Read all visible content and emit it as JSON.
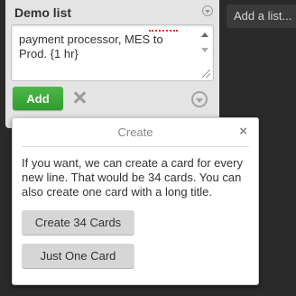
{
  "list": {
    "title": "Demo list",
    "composer_text": "payment processor, MES to Prod. {1 hr}",
    "add_label": "Add"
  },
  "add_list": {
    "label": "Add a list..."
  },
  "popover": {
    "title": "Create",
    "close_label": "×",
    "message": "If you want, we can create a card for every new line. That would be 34 cards. You can also create one card with a long title.",
    "create_many_label": "Create 34 Cards",
    "just_one_label": "Just One Card"
  }
}
